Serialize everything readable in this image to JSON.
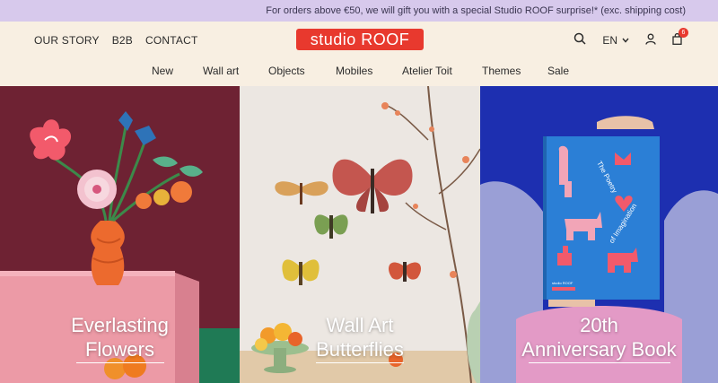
{
  "promo": {
    "text": "For orders above €50, we will gift you with a special Studio ROOF surprise!* (exc. shipping cost)"
  },
  "header": {
    "left_nav": [
      "OUR STORY",
      "B2B",
      "CONTACT"
    ],
    "logo": "studio ROOF",
    "language": "EN",
    "cart_count": "6"
  },
  "main_nav": [
    "New",
    "Wall art",
    "Objects",
    "Mobiles",
    "Atelier Toit",
    "Themes",
    "Sale"
  ],
  "hero": [
    {
      "line1": "Everlasting",
      "line2": "Flowers"
    },
    {
      "line1": "Wall Art",
      "line2": "Butterflies"
    },
    {
      "line1": "20th",
      "line2": "Anniversary Book"
    }
  ],
  "book": {
    "title_line1": "The Poetry",
    "title_line2": "of Imagination",
    "brand": "studio ROOF"
  },
  "colors": {
    "accent": "#e8392e",
    "promo_bg": "#d7c9ec",
    "header_bg": "#f8efe2"
  }
}
